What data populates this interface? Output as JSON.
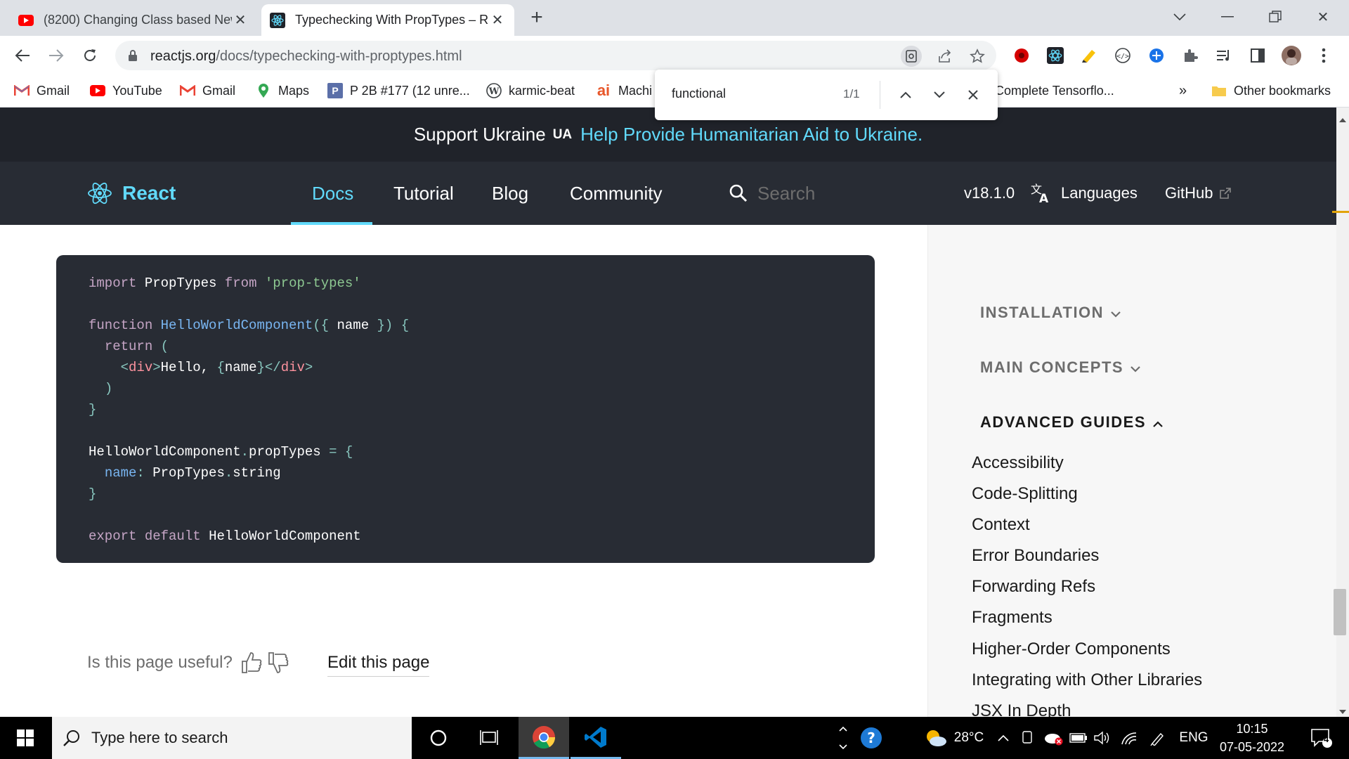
{
  "tabs": [
    {
      "title": "(8200) Changing Class based New",
      "icon": "youtube-icon",
      "active": false
    },
    {
      "title": "Typechecking With PropTypes – R",
      "icon": "react-icon",
      "active": true
    }
  ],
  "toolbar": {
    "url_host": "reactjs.org",
    "url_path": "/docs/typechecking-with-proptypes.html"
  },
  "bookmarks": [
    {
      "label": "Gmail",
      "icon": "gmail-icon"
    },
    {
      "label": "YouTube",
      "icon": "youtube-icon"
    },
    {
      "label": "Gmail",
      "icon": "gmail-icon"
    },
    {
      "label": "Maps",
      "icon": "maps-icon"
    },
    {
      "label": "P 2B #177 (12 unre...",
      "icon": "p-icon"
    },
    {
      "label": "karmic-beat",
      "icon": "wordpress-icon"
    },
    {
      "label": "Machi",
      "icon": "ai-icon"
    },
    {
      "label": "Complete Tensorflo...",
      "icon": ""
    },
    {
      "label": "»",
      "icon": ""
    },
    {
      "label": "Other bookmarks",
      "icon": "folder-icon"
    }
  ],
  "findbar": {
    "query": "functional",
    "count": "1/1"
  },
  "banner": {
    "support": "Support Ukraine",
    "ua": "UA",
    "help": "Help Provide Humanitarian Aid to Ukraine."
  },
  "nav": {
    "logo": "React",
    "links": [
      "Docs",
      "Tutorial",
      "Blog",
      "Community"
    ],
    "search_placeholder": "Search",
    "version": "v18.1.0",
    "languages": "Languages",
    "github": "GitHub"
  },
  "code": {
    "line1": {
      "kw1": "import",
      "name": "PropTypes",
      "kw2": "from",
      "str": "'prop-types'"
    },
    "line2": {
      "kw": "function",
      "fn": "HelloWorldComponent",
      "p1": "({",
      "arg": "name",
      "p2": "}) {"
    },
    "line3": {
      "kw": "return",
      "p": "("
    },
    "line4": {
      "lt": "<",
      "tag1": "div",
      "gt": ">",
      "text": "Hello, ",
      "b1": "{",
      "var": "name",
      "b2": "}",
      "close": "</",
      "tag2": "div",
      "gt2": ">"
    },
    "line5": ")",
    "line6": "}",
    "line7": {
      "name": "HelloWorldComponent",
      "dot": ".",
      "prop": "propTypes",
      "eq": " = {"
    },
    "line8": {
      "key": "name",
      "colon": ": ",
      "val": "PropTypes",
      "dot": ".",
      "type": "string"
    },
    "line9": "}",
    "line10": {
      "kw1": "export",
      "kw2": "default",
      "name": "HelloWorldComponent"
    }
  },
  "feedback": {
    "question": "Is this page useful?",
    "edit": "Edit this page"
  },
  "sidebar": {
    "sections": [
      {
        "label": "INSTALLATION",
        "open": false
      },
      {
        "label": "MAIN CONCEPTS",
        "open": false
      },
      {
        "label": "ADVANCED GUIDES",
        "open": true
      }
    ],
    "items": [
      "Accessibility",
      "Code-Splitting",
      "Context",
      "Error Boundaries",
      "Forwarding Refs",
      "Fragments",
      "Higher-Order Components",
      "Integrating with Other Libraries",
      "JSX In Depth"
    ]
  },
  "taskbar": {
    "search_placeholder": "Type here to search",
    "weather": "28°C",
    "lang": "ENG",
    "time": "10:15",
    "date": "07-05-2022",
    "notifications": "4"
  },
  "colors": {
    "react_blue": "#61dafb",
    "nav_bg": "#282c34",
    "banner_bg": "#20232a"
  }
}
